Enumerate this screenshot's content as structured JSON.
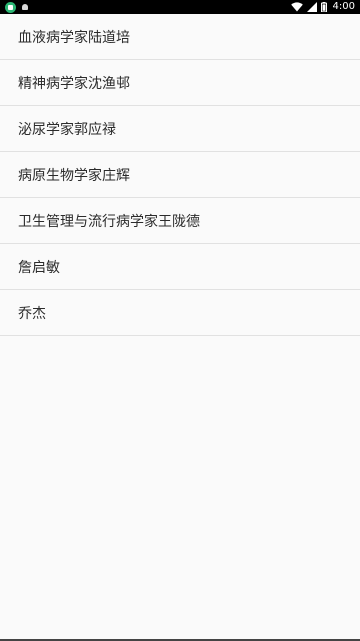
{
  "status_bar": {
    "time": "4:00",
    "icons": [
      "app-notification-icon",
      "android-icon",
      "wifi-icon",
      "cellular-signal-icon",
      "battery-icon"
    ]
  },
  "list": {
    "items": [
      {
        "label": "血液病学家陆道培"
      },
      {
        "label": "精神病学家沈渔邨"
      },
      {
        "label": "泌尿学家郭应禄"
      },
      {
        "label": "病原生物学家庄辉"
      },
      {
        "label": "卫生管理与流行病学家王陇德"
      },
      {
        "label": "詹启敏"
      },
      {
        "label": "乔杰"
      }
    ]
  },
  "colors": {
    "background": "#fafafa",
    "status_bar": "#000000",
    "divider": "#e1e1e1",
    "text": "#2b2b2b",
    "notification_accent": "#2bb673"
  }
}
